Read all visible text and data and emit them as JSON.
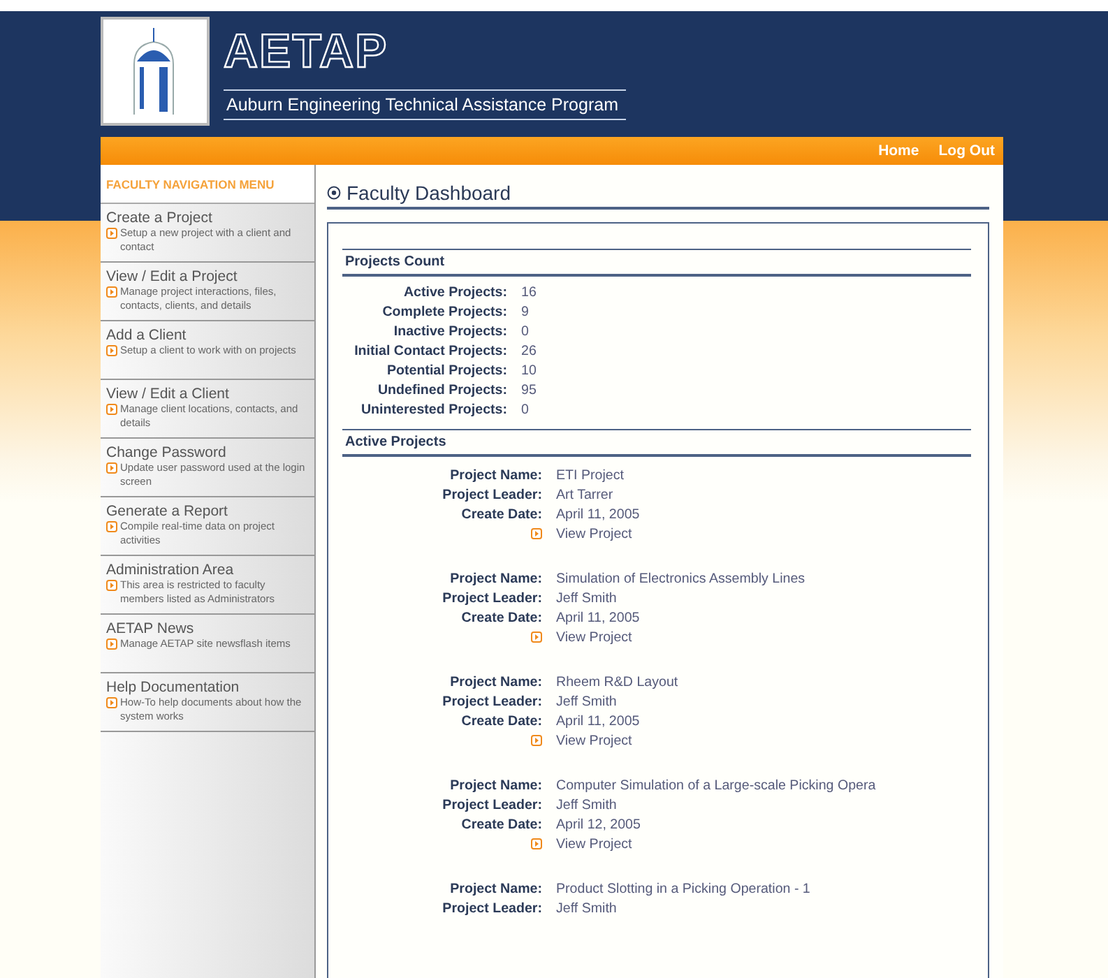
{
  "header": {
    "title": "AETAP",
    "subtitle": "Auburn Engineering Technical Assistance Program"
  },
  "top_nav": [
    "Home",
    "Log Out"
  ],
  "sidebar": {
    "heading": "FACULTY NAVIGATION MENU",
    "items": [
      {
        "title": "Create a Project",
        "description": "Setup a new project with a client and contact"
      },
      {
        "title": "View / Edit a Project",
        "description": "Manage project interactions, files, contacts, clients, and details"
      },
      {
        "title": "Add a Client",
        "description": "Setup a client to work with on projects"
      },
      {
        "title": "View / Edit a Client",
        "description": "Manage client locations, contacts, and details"
      },
      {
        "title": "Change Password",
        "description": "Update user password used at the login screen"
      },
      {
        "title": "Generate a Report",
        "description": "Compile real-time data on project activities"
      },
      {
        "title": "Administration Area",
        "description": "This area is restricted to faculty members listed as Administrators"
      },
      {
        "title": "AETAP News",
        "description": "Manage AETAP site newsflash items"
      },
      {
        "title": "Help Documentation",
        "description": "How-To help documents about how the system works"
      }
    ]
  },
  "page_title": "Faculty Dashboard",
  "projects_count": {
    "heading": "Projects Count",
    "rows": [
      {
        "label": "Active Projects:",
        "value": "16"
      },
      {
        "label": "Complete Projects:",
        "value": "9"
      },
      {
        "label": "Inactive Projects:",
        "value": "0"
      },
      {
        "label": "Initial Contact Projects:",
        "value": "26"
      },
      {
        "label": "Potential Projects:",
        "value": "10"
      },
      {
        "label": "Undefined Projects:",
        "value": "95"
      },
      {
        "label": "Uninterested Projects:",
        "value": "0"
      }
    ]
  },
  "active_projects": {
    "heading": "Active Projects",
    "projects": [
      {
        "fields": [
          {
            "label": "Project Name:",
            "value": "ETI Project"
          },
          {
            "label": "Project Leader:",
            "value": "Art Tarrer"
          },
          {
            "label": "Create Date:",
            "value": "April 11, 2005"
          }
        ],
        "link": "View Project"
      },
      {
        "fields": [
          {
            "label": "Project Name:",
            "value": "Simulation of Electronics Assembly Lines"
          },
          {
            "label": "Project Leader:",
            "value": "Jeff Smith"
          },
          {
            "label": "Create Date:",
            "value": "April 11, 2005"
          }
        ],
        "link": "View Project"
      },
      {
        "fields": [
          {
            "label": "Project Name:",
            "value": "Rheem R&D Layout"
          },
          {
            "label": "Project Leader:",
            "value": "Jeff Smith"
          },
          {
            "label": "Create Date:",
            "value": "April 11, 2005"
          }
        ],
        "link": "View Project"
      },
      {
        "fields": [
          {
            "label": "Project Name:",
            "value": "Computer Simulation of a Large-scale Picking Opera"
          },
          {
            "label": "Project Leader:",
            "value": "Jeff Smith"
          },
          {
            "label": "Create Date:",
            "value": "April 12, 2005"
          }
        ],
        "link": "View Project"
      },
      {
        "fields": [
          {
            "label": "Project Name:",
            "value": "Product Slotting in a Picking Operation - 1"
          },
          {
            "label": "Project Leader:",
            "value": "Jeff Smith"
          }
        ]
      }
    ]
  }
}
